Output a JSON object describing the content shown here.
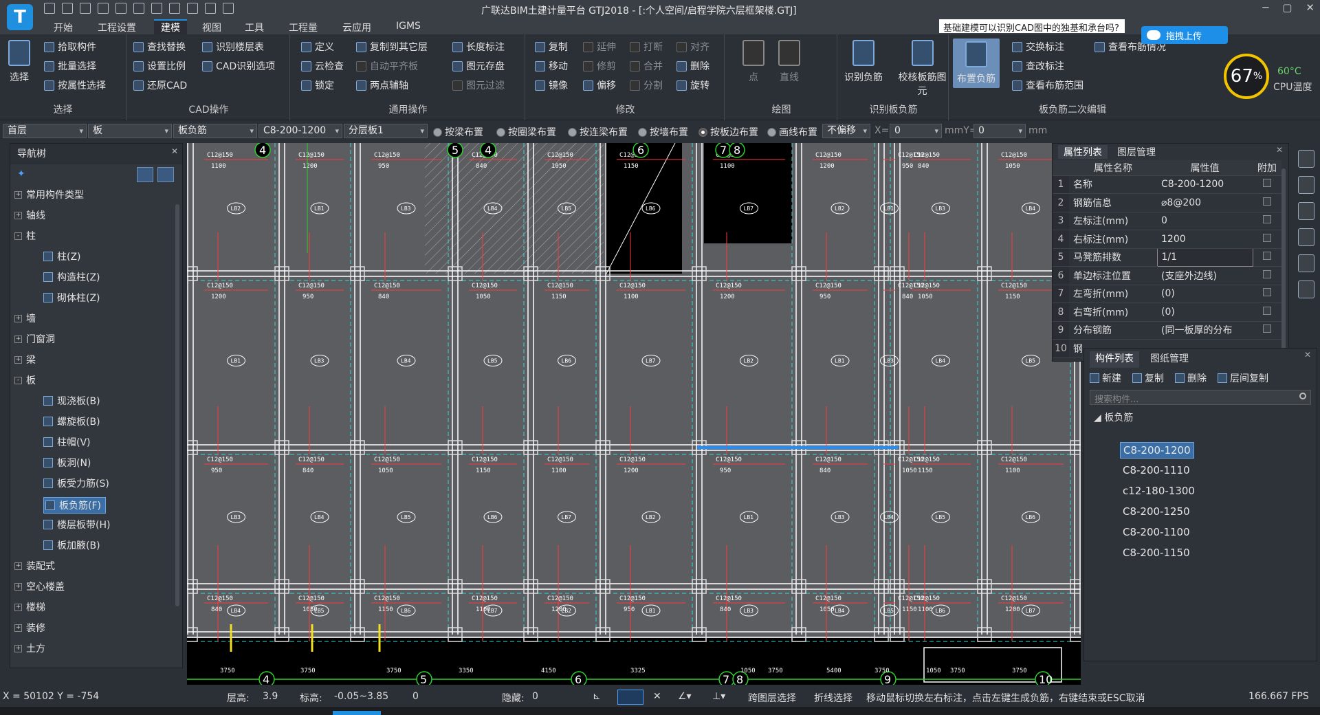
{
  "app": {
    "logo_letter": "T",
    "title": "广联达BIM土建计量平台 GTJ2018 - [:个人空间/启程学院六层框架楼.GTJ]",
    "help_query": "基础建模可以识别CAD图中的独基和承台吗?",
    "upload_label": "拖拽上传"
  },
  "menu": {
    "tabs": [
      "开始",
      "工程设置",
      "建模",
      "视图",
      "工具",
      "工程量",
      "云应用",
      "IGMS"
    ],
    "active": "建模"
  },
  "ribbon": {
    "select": {
      "big": "选择",
      "items": [
        "拾取构件",
        "批量选择",
        "按属性选择"
      ],
      "label": "选择"
    },
    "cad": {
      "items": [
        "查找替换",
        "设置比例",
        "还原CAD",
        "识别楼层表",
        "CAD识别选项"
      ],
      "label": "CAD操作"
    },
    "common": {
      "items": [
        "定义",
        "云检查",
        "锁定",
        "复制到其它层",
        "自动平齐板",
        "两点辅轴",
        "长度标注",
        "图元存盘",
        "图元过滤"
      ],
      "label": "通用操作"
    },
    "modify": {
      "items": [
        "复制",
        "移动",
        "镜像",
        "延伸",
        "修剪",
        "偏移",
        "打断",
        "合并",
        "分割",
        "对齐",
        "删除",
        "旋转"
      ],
      "label": "修改"
    },
    "draw": {
      "items": [
        "点",
        "直线"
      ],
      "label": "绘图"
    },
    "recognize": {
      "items": [
        "识别负筋",
        "校核板筋图元"
      ],
      "label": "识别板负筋"
    },
    "edit2": {
      "big": "布置负筋",
      "items": [
        "交换标注",
        "查改标注",
        "查看布筋范围",
        "查看布筋情况"
      ],
      "label": "板负筋二次编辑"
    },
    "cpu": {
      "percent": "67",
      "unit": "%",
      "temp": "60°C",
      "temp_label": "CPU温度"
    }
  },
  "filters": {
    "floor": "首层",
    "category": "板",
    "type": "板负筋",
    "component": "C8-200-1200",
    "layer": "分层板1",
    "modes": [
      "按梁布置",
      "按圈梁布置",
      "按连梁布置",
      "按墙布置",
      "按板边布置",
      "画线布置"
    ],
    "active_mode": "按板边布置",
    "offset": "不偏移",
    "x_label": "X=",
    "x_value": "0",
    "y_label": "mmY=",
    "y_value": "0",
    "unit": "mm"
  },
  "nav": {
    "title": "导航树",
    "items": [
      {
        "label": "常用构件类型",
        "level": 0,
        "expand": "+"
      },
      {
        "label": "轴线",
        "level": 0,
        "expand": "+"
      },
      {
        "label": "柱",
        "level": 0,
        "expand": "-"
      },
      {
        "label": "柱(Z)",
        "level": 1
      },
      {
        "label": "构造柱(Z)",
        "level": 1
      },
      {
        "label": "砌体柱(Z)",
        "level": 1
      },
      {
        "label": "墙",
        "level": 0,
        "expand": "+"
      },
      {
        "label": "门窗洞",
        "level": 0,
        "expand": "+"
      },
      {
        "label": "梁",
        "level": 0,
        "expand": "+"
      },
      {
        "label": "板",
        "level": 0,
        "expand": "-"
      },
      {
        "label": "现浇板(B)",
        "level": 1
      },
      {
        "label": "螺旋板(B)",
        "level": 1
      },
      {
        "label": "柱帽(V)",
        "level": 1
      },
      {
        "label": "板洞(N)",
        "level": 1
      },
      {
        "label": "板受力筋(S)",
        "level": 1
      },
      {
        "label": "板负筋(F)",
        "level": 1,
        "selected": true
      },
      {
        "label": "楼层板带(H)",
        "level": 1
      },
      {
        "label": "板加腋(B)",
        "level": 1
      },
      {
        "label": "装配式",
        "level": 0,
        "expand": "+"
      },
      {
        "label": "空心楼盖",
        "level": 0,
        "expand": "+"
      },
      {
        "label": "楼梯",
        "level": 0,
        "expand": "+"
      },
      {
        "label": "装修",
        "level": 0,
        "expand": "+"
      },
      {
        "label": "土方",
        "level": 0,
        "expand": "+"
      }
    ]
  },
  "props": {
    "tabs": [
      "属性列表",
      "图层管理"
    ],
    "headers": [
      "属性名称",
      "属性值",
      "附加"
    ],
    "rows": [
      {
        "n": "1",
        "name": "名称",
        "value": "C8-200-1200",
        "blue": true
      },
      {
        "n": "2",
        "name": "钢筋信息",
        "value": "⌀8@200",
        "blue": true
      },
      {
        "n": "3",
        "name": "左标注(mm)",
        "value": "0"
      },
      {
        "n": "4",
        "name": "右标注(mm)",
        "value": "1200"
      },
      {
        "n": "5",
        "name": "马凳筋排数",
        "value": "1/1",
        "edit": true
      },
      {
        "n": "6",
        "name": "单边标注位置",
        "value": "(支座外边线)"
      },
      {
        "n": "7",
        "name": "左弯折(mm)",
        "value": "(0)"
      },
      {
        "n": "8",
        "name": "右弯折(mm)",
        "value": "(0)"
      },
      {
        "n": "9",
        "name": "分布钢筋",
        "value": "(同一板厚的分布"
      },
      {
        "n": "10",
        "name": "钢",
        "value": ""
      }
    ]
  },
  "components": {
    "tabs": [
      "构件列表",
      "图纸管理"
    ],
    "toolbar": [
      "新建",
      "复制",
      "删除",
      "层间复制"
    ],
    "search_placeholder": "搜索构件...",
    "group": "板负筋",
    "items": [
      "C8-200-1200",
      "C8-200-1110",
      "c12-180-1300",
      "C8-200-1250",
      "C8-200-1100",
      "C8-200-1150"
    ],
    "selected": "C8-200-1200"
  },
  "canvas": {
    "axis_top": [
      "4",
      "5",
      "4",
      "6",
      "7",
      "8"
    ],
    "axis_bottom": [
      "4",
      "5",
      "6",
      "7",
      "8",
      "9",
      "10"
    ],
    "dims_bottom": [
      "3750",
      "3750",
      "3750",
      "3350",
      "4150",
      "3325",
      "1050",
      "3750",
      "5400",
      "3750",
      "1050",
      "3750",
      "3750"
    ],
    "rebar_label": "C12@150",
    "slab_labels": [
      "LB2",
      "LB1",
      "LB3",
      "LB4",
      "LB5",
      "LB6",
      "LB7"
    ],
    "span_values": [
      "1100",
      "1200",
      "950",
      "840",
      "1050",
      "1150"
    ]
  },
  "status": {
    "coords": "X = 50102 Y = -754",
    "floor_height_label": "层高:",
    "floor_height": "3.9",
    "elev_label": "标高:",
    "elev": "-0.05~3.85",
    "zero": "0",
    "hidden_label": "隐藏:",
    "hidden": "0",
    "cross_layer": "跨图层选择",
    "polyline_select": "折线选择",
    "hint": "移动鼠标切换左右标注，点击左键生成负筋，右键结束或ESC取消",
    "fps": "166.667 FPS"
  }
}
